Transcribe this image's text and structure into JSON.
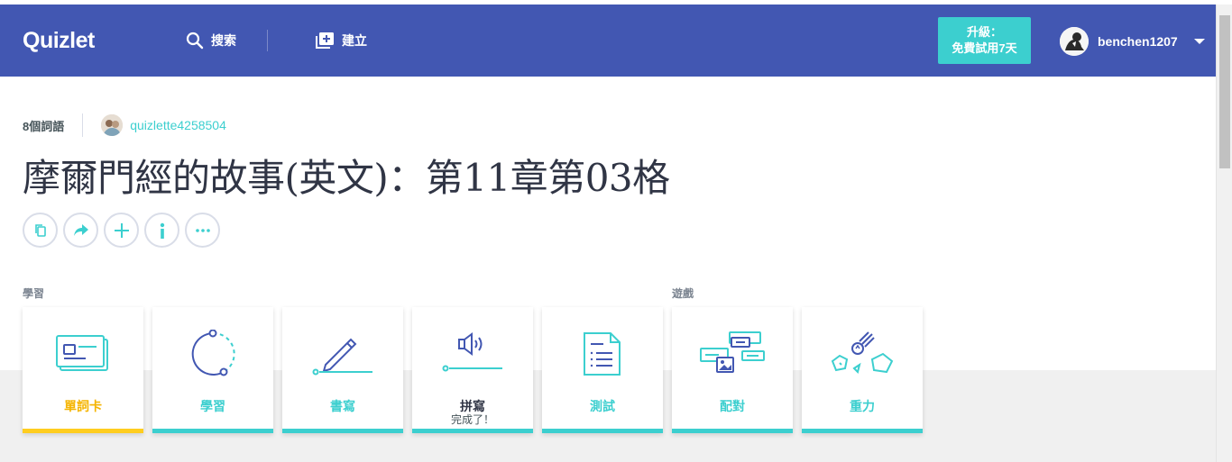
{
  "header": {
    "logo": "Quizlet",
    "search_label": "搜索",
    "create_label": "建立",
    "upgrade_line1": "升級：",
    "upgrade_line2": "免費試用7天",
    "username": "benchen1207"
  },
  "set": {
    "term_count": "8個詞語",
    "author": "quizlette4258504",
    "title": "摩爾門經的故事(英文)：第11章第03格"
  },
  "sections": {
    "study": "學習",
    "games": "遊戲"
  },
  "cards": [
    {
      "label": "單詞卡"
    },
    {
      "label": "學習"
    },
    {
      "label": "書寫"
    },
    {
      "label": "拼寫",
      "sublabel": "完成了！"
    },
    {
      "label": "測試"
    },
    {
      "label": "配對"
    },
    {
      "label": "重力"
    }
  ],
  "colors": {
    "header_bg": "#4257b2",
    "accent": "#3ccfcf",
    "active": "#ffcd1f",
    "icon_blue": "#4257b2"
  }
}
